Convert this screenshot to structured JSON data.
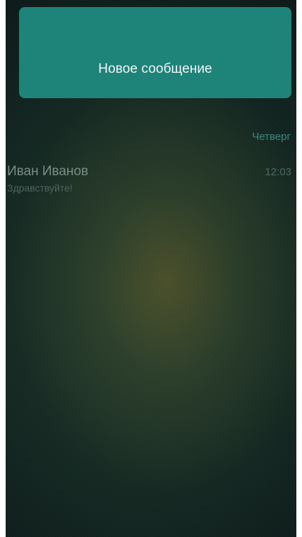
{
  "compose": {
    "label": "Новое сообщение"
  },
  "conversations": {
    "day_header": "Четверг",
    "items": [
      {
        "name": "Иван Иванов",
        "preview": "Здравствуйте!",
        "time": "12:03"
      }
    ]
  },
  "colors": {
    "accent": "#1e8379",
    "day_header": "#3a8a80",
    "background_dark": "#0b1718",
    "background_glow": "#6e6428"
  }
}
